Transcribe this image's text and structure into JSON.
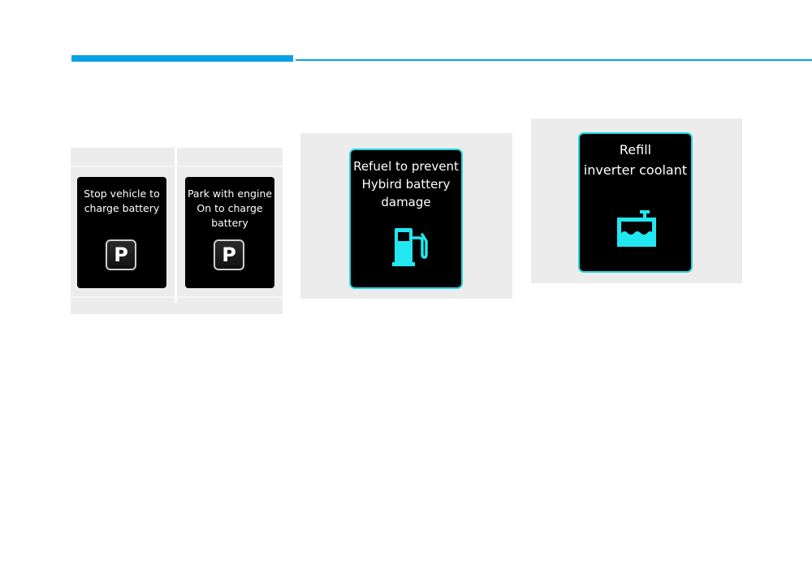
{
  "colors": {
    "accent_rule": "#0aa0e6",
    "panel_bg": "#ececec",
    "screen_bg": "#000000",
    "screen_border_cyan": "#22d8e0",
    "icon_cyan": "#22e6f0"
  },
  "panels": [
    {
      "screens": [
        {
          "message": "Stop vehicle to\ncharge battery",
          "icon": "P",
          "icon_name": "park-p-icon"
        },
        {
          "message": "Park with engine\nOn to charge\nbattery",
          "icon": "P",
          "icon_name": "park-p-icon"
        }
      ]
    },
    {
      "screens": [
        {
          "message": "Refuel to prevent\nHybird battery\ndamage",
          "icon_name": "fuel-pump-icon"
        }
      ]
    },
    {
      "screens": [
        {
          "message": "Refill\ninverter coolant",
          "icon_name": "coolant-reservoir-icon"
        }
      ]
    }
  ]
}
